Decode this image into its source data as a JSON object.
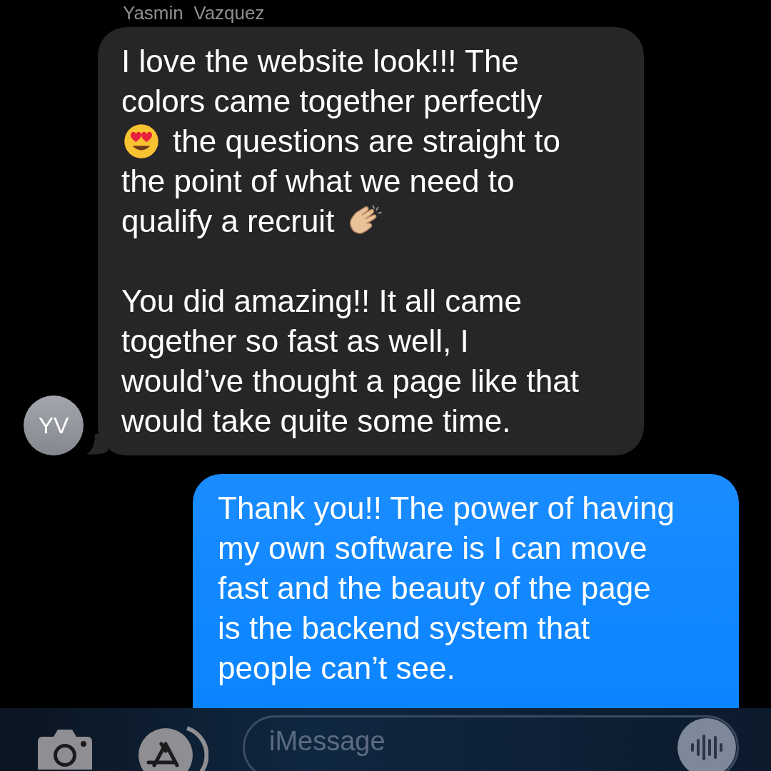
{
  "conversation": {
    "contact_name": "Yasmin  Vazquez"
  },
  "messages": [
    {
      "kind": "received",
      "avatar": "YV",
      "paragraphs": [
        [
          [
            {
              "kind": "text",
              "text": "I love the website look!!! The"
            }
          ],
          [
            {
              "kind": "text",
              "text": "colors came together perfectly"
            }
          ],
          [
            {
              "kind": "face-emoji"
            },
            {
              "kind": "text",
              "text": "the questions are straight to"
            }
          ],
          [
            {
              "kind": "text",
              "text": "the point of what we need to"
            }
          ],
          [
            {
              "kind": "text",
              "text": "qualify a recruit"
            },
            {
              "kind": "clap-emoji"
            }
          ]
        ],
        [
          [
            {
              "kind": "text",
              "text": "You did amazing!! It all came"
            }
          ],
          [
            {
              "kind": "text",
              "text": "together so fast as well, I"
            }
          ],
          [
            {
              "kind": "text",
              "text": "would’ve thought a page like that"
            }
          ],
          [
            {
              "kind": "text",
              "text": "would take quite some time."
            }
          ]
        ]
      ]
    },
    {
      "kind": "sent",
      "paragraphs": [
        [
          [
            {
              "kind": "text",
              "text": "Thank you!! The power of having"
            }
          ],
          [
            {
              "kind": "text",
              "text": "my own software is I can move"
            }
          ],
          [
            {
              "kind": "text",
              "text": "fast and the beauty of the page"
            }
          ],
          [
            {
              "kind": "text",
              "text": "is the backend system that"
            }
          ],
          [
            {
              "kind": "text",
              "text": "people can’t see."
            }
          ]
        ]
      ]
    }
  ],
  "compose": {
    "placeholder": "iMessage"
  }
}
